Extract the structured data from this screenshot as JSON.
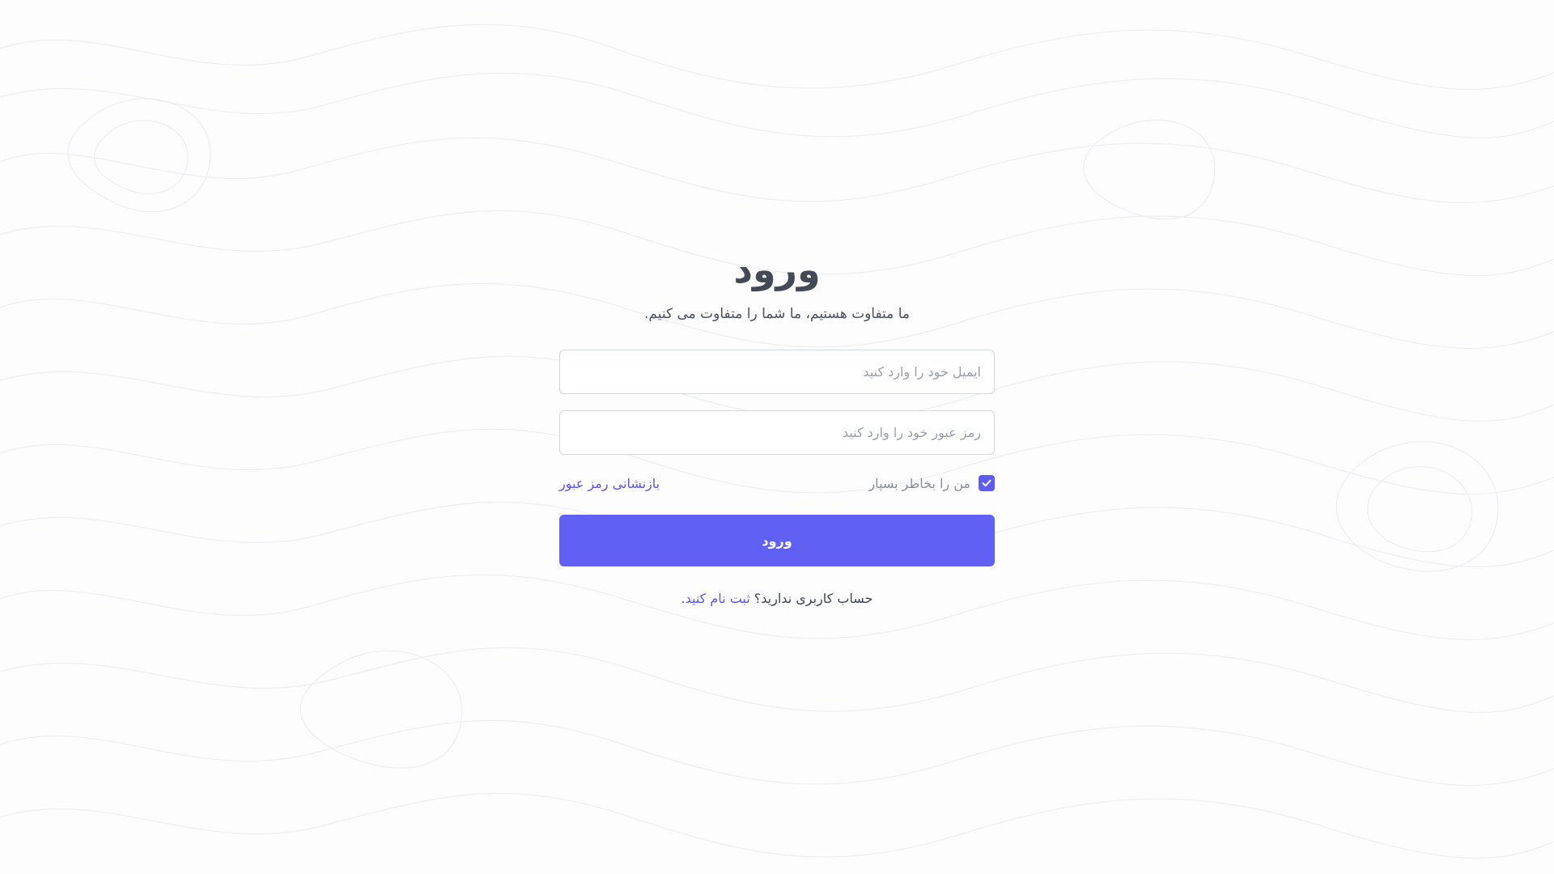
{
  "login": {
    "title": "ورود",
    "subtitle": "ما متفاوت هستیم، ما شما را متفاوت می کنیم.",
    "email_placeholder": "ایمیل خود را وارد کنید",
    "password_placeholder": "رمز عبور خود را وارد کنید",
    "remember_label": "من را بخاطر بسپار",
    "remember_checked": true,
    "reset_link": "بازنشانی رمز عبور",
    "submit_label": "ورود",
    "signup_prompt": "حساب کاربری ندارید؟",
    "signup_link": "ثبت نام کنید."
  },
  "colors": {
    "accent": "#6160f5",
    "link": "#5a55e6",
    "background": "#fdfdfe",
    "topo_lines": "#eceef2"
  },
  "icons": {
    "checkbox": "check-icon"
  }
}
